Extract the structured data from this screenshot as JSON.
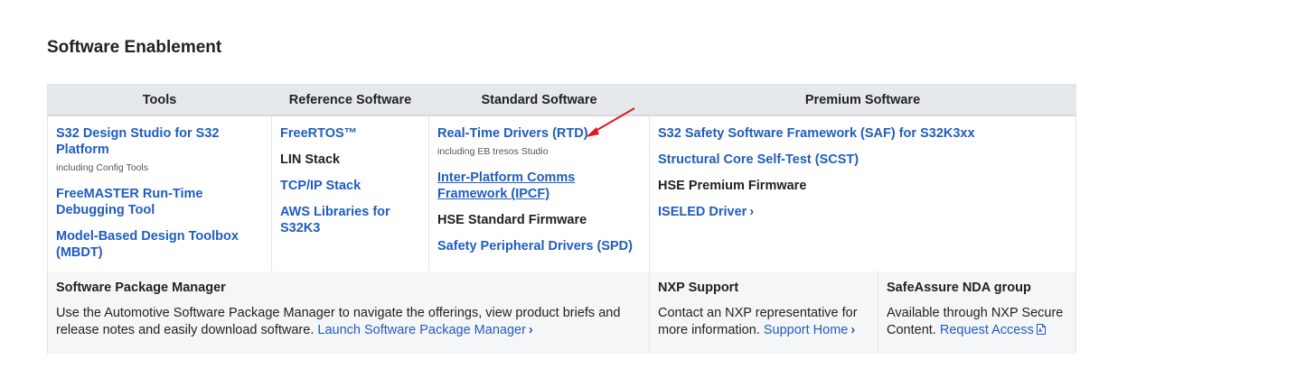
{
  "title": "Software Enablement",
  "headers": {
    "tools": "Tools",
    "reference": "Reference Software",
    "standard": "Standard Software",
    "premium": "Premium Software"
  },
  "tools": [
    {
      "label": "S32 Design Studio for S32 Platform",
      "sub": "including Config Tools"
    },
    {
      "label": "FreeMASTER Run-Time Debugging Tool"
    },
    {
      "label": "Model-Based Design Toolbox (MBDT)"
    }
  ],
  "reference": [
    {
      "label": "FreeRTOS™"
    },
    {
      "label": "LIN Stack"
    },
    {
      "label": "TCP/IP Stack"
    },
    {
      "label": "AWS Libraries for S32K3"
    }
  ],
  "standard": [
    {
      "label": "Real-Time Drivers (RTD)",
      "sub": "including EB tresos Studio"
    },
    {
      "label": "Inter-Platform Comms Framework (IPCF)"
    },
    {
      "label": "HSE Standard Firmware"
    },
    {
      "label": "Safety Peripheral Drivers (SPD)"
    }
  ],
  "premium": [
    {
      "label": "S32 Safety Software Framework (SAF) for S32K3xx"
    },
    {
      "label": "Structural Core Self-Test (SCST)"
    },
    {
      "label": "HSE Premium Firmware"
    },
    {
      "label": "ISELED Driver"
    }
  ],
  "chevron": "›",
  "footer": {
    "spm": {
      "title": "Software Package Manager",
      "text": "Use the Automotive Software Package Manager to navigate the offerings, view product briefs and release notes and easily download software.",
      "link": "Launch Software Package Manager"
    },
    "support": {
      "title": "NXP Support",
      "text": "Contact an NXP representative for more information.",
      "link": "Support Home"
    },
    "nda": {
      "title": "SafeAssure NDA group",
      "text": "Available through NXP Secure Content.",
      "link": "Request Access",
      "icon": "pdf-icon"
    }
  },
  "colors": {
    "link": "#1f5dbf",
    "header_bg": "#e6e9eb",
    "footer_bg": "#f5f6f7",
    "annotation_arrow": "#e0191f"
  }
}
